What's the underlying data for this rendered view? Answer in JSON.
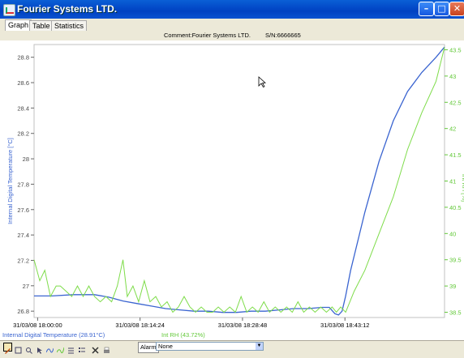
{
  "window": {
    "title": "Fourier Systems LTD.",
    "buttons": {
      "minimize": "–",
      "maximize": "□",
      "close": "✕"
    }
  },
  "tabs": [
    {
      "label": "Graph",
      "active": true
    },
    {
      "label": "Table",
      "active": false
    },
    {
      "label": "Statistics",
      "active": false
    }
  ],
  "header": {
    "comment": "Comment:Fourier Systems LTD.",
    "serial": "S/N:6666665"
  },
  "chart_data": {
    "type": "line",
    "colors": {
      "left_axis": "#3a64d0",
      "right_axis": "#62c838",
      "temperature": "#3a64d0",
      "humidity": "#7edc4a"
    },
    "left_axis": {
      "label": "Internal Digital Temperature [°C]",
      "ylim": [
        26.75,
        28.9
      ],
      "ticks": [
        "26.8",
        "27",
        "27.2",
        "27.4",
        "27.6",
        "27.8",
        "28",
        "28.2",
        "28.4",
        "28.6",
        "28.8"
      ]
    },
    "right_axis": {
      "label": "Int RH [%]",
      "ylim": [
        38.4,
        43.6
      ],
      "ticks": [
        "38.5",
        "39",
        "39.5",
        "40",
        "40.5",
        "41",
        "41.5",
        "42",
        "42.5",
        "43",
        "43.5"
      ]
    },
    "x_axis": {
      "range": [
        -0.5,
        57.2
      ],
      "ticks": [
        {
          "value": 0,
          "label": "31/03/08 18:00:00"
        },
        {
          "value": 14.4,
          "label": "31/03/08 18:14:24"
        },
        {
          "value": 28.8,
          "label": "31/03/08 18:28:48"
        },
        {
          "value": 43.2,
          "label": "31/03/08 18:43:12"
        }
      ]
    },
    "series": [
      {
        "axis": "left",
        "x": [
          -0.5,
          2,
          5,
          8,
          10,
          12,
          14,
          16,
          18,
          20,
          22,
          24,
          26,
          28,
          30,
          32,
          34,
          36,
          38,
          40,
          41,
          41.8,
          42.3,
          42.8,
          43.3,
          44,
          46,
          48,
          50,
          52,
          54,
          56,
          57.2
        ],
        "y": [
          26.92,
          26.92,
          26.93,
          26.93,
          26.91,
          26.88,
          26.86,
          26.84,
          26.82,
          26.81,
          26.8,
          26.8,
          26.79,
          26.79,
          26.8,
          26.8,
          26.81,
          26.82,
          26.82,
          26.83,
          26.83,
          26.78,
          26.77,
          26.8,
          26.92,
          27.12,
          27.58,
          27.98,
          28.3,
          28.53,
          28.68,
          28.8,
          28.88
        ]
      },
      {
        "axis": "right",
        "x": [
          -0.5,
          0.3,
          1,
          1.8,
          2.6,
          3.2,
          4,
          4.8,
          5.6,
          6.4,
          7.2,
          8,
          8.8,
          9.6,
          10.4,
          11.2,
          12,
          12.6,
          13.4,
          14.2,
          15,
          15.8,
          16.6,
          17.4,
          18.2,
          19,
          19.8,
          20.6,
          21.4,
          22.2,
          23,
          23.8,
          24.6,
          25.4,
          26.2,
          27,
          27.8,
          28.6,
          29.4,
          30.2,
          31,
          31.8,
          32.6,
          33.4,
          34.2,
          35,
          35.8,
          36.6,
          37.4,
          38.2,
          39,
          39.8,
          40.6,
          41.4,
          42,
          42.6,
          43.3,
          44.5,
          46,
          48,
          50,
          52,
          54,
          56,
          57.2
        ],
        "y": [
          39.5,
          39.1,
          39.3,
          38.8,
          39,
          39,
          38.9,
          38.8,
          39,
          38.8,
          39,
          38.8,
          38.7,
          38.8,
          38.7,
          39,
          39.5,
          38.8,
          39,
          38.7,
          39.1,
          38.7,
          38.8,
          38.6,
          38.7,
          38.5,
          38.6,
          38.8,
          38.6,
          38.5,
          38.6,
          38.5,
          38.5,
          38.6,
          38.5,
          38.6,
          38.5,
          38.8,
          38.5,
          38.6,
          38.5,
          38.7,
          38.5,
          38.6,
          38.5,
          38.6,
          38.5,
          38.7,
          38.5,
          38.6,
          38.5,
          38.6,
          38.5,
          38.6,
          38.5,
          38.6,
          38.5,
          38.9,
          39.3,
          40,
          40.7,
          41.6,
          42.3,
          42.9,
          43.55
        ]
      }
    ]
  },
  "status": {
    "left_readout": "Internal Digital Temperature (28.91°C)",
    "right_readout": "Int RH (43.72%)"
  },
  "toolbar": {
    "icons": [
      "pointer-icon",
      "zoom-box-icon",
      "magnifier-icon",
      "cursor-icon",
      "spline-icon",
      "autoscale-icon",
      "filter-icon",
      "list-icon",
      "delete-icon",
      "print-icon"
    ],
    "alarm_label": "Alarm",
    "alarm_value": "None"
  }
}
